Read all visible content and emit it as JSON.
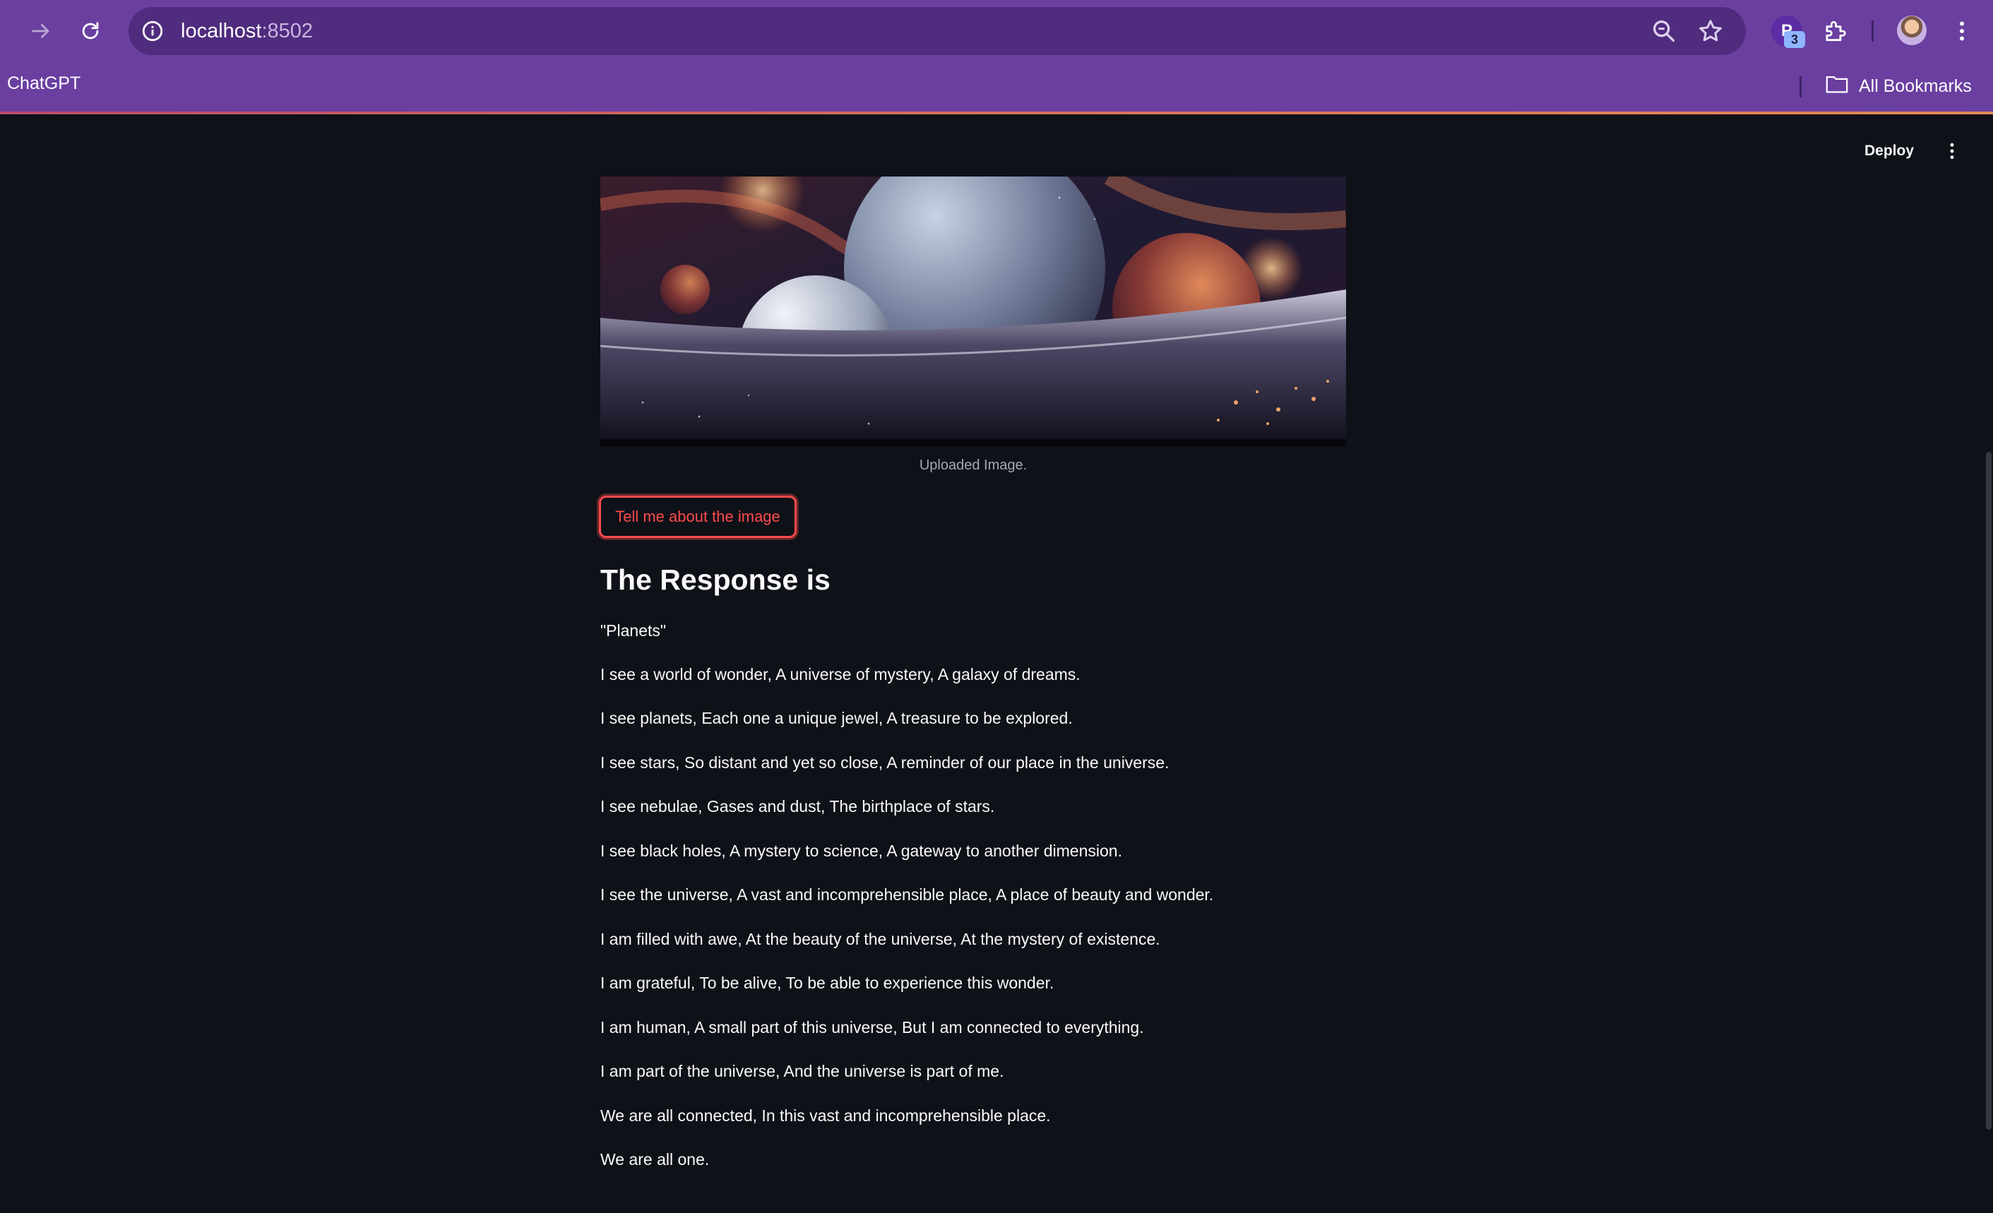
{
  "browser": {
    "url_host": "localhost",
    "url_port": ":8502",
    "bookmark": "ChatGPT",
    "all_bookmarks": "All Bookmarks",
    "extension_letter": "P",
    "extension_badge": "3",
    "icons": [
      "forward-icon",
      "reload-icon",
      "site-info-icon",
      "zoom-icon",
      "star-icon",
      "extensions-icon",
      "profile-avatar",
      "browser-menu-icon",
      "folder-icon"
    ]
  },
  "app": {
    "deploy_label": "Deploy",
    "image_caption": "Uploaded Image.",
    "button_label": "Tell me about the image",
    "response_heading": "The Response is",
    "poem_lines": [
      "\"Planets\"",
      "I see a world of wonder, A universe of mystery, A galaxy of dreams.",
      "I see planets, Each one a unique jewel, A treasure to be explored.",
      "I see stars, So distant and yet so close, A reminder of our place in the universe.",
      "I see nebulae, Gases and dust, The birthplace of stars.",
      "I see black holes, A mystery to science, A gateway to another dimension.",
      "I see the universe, A vast and incomprehensible place, A place of beauty and wonder.",
      "I am filled with awe, At the beauty of the universe, At the mystery of existence.",
      "I am grateful, To be alive, To be able to experience this wonder.",
      "I am human, A small part of this universe, But I am connected to everything.",
      "I am part of the universe, And the universe is part of me.",
      "We are all connected, In this vast and incomprehensible place.",
      "We are all one."
    ]
  },
  "colors": {
    "chrome": "#6a3fa0",
    "app_background": "#0e1117",
    "accent": "#ff4b4b",
    "text": "#fafafa"
  }
}
